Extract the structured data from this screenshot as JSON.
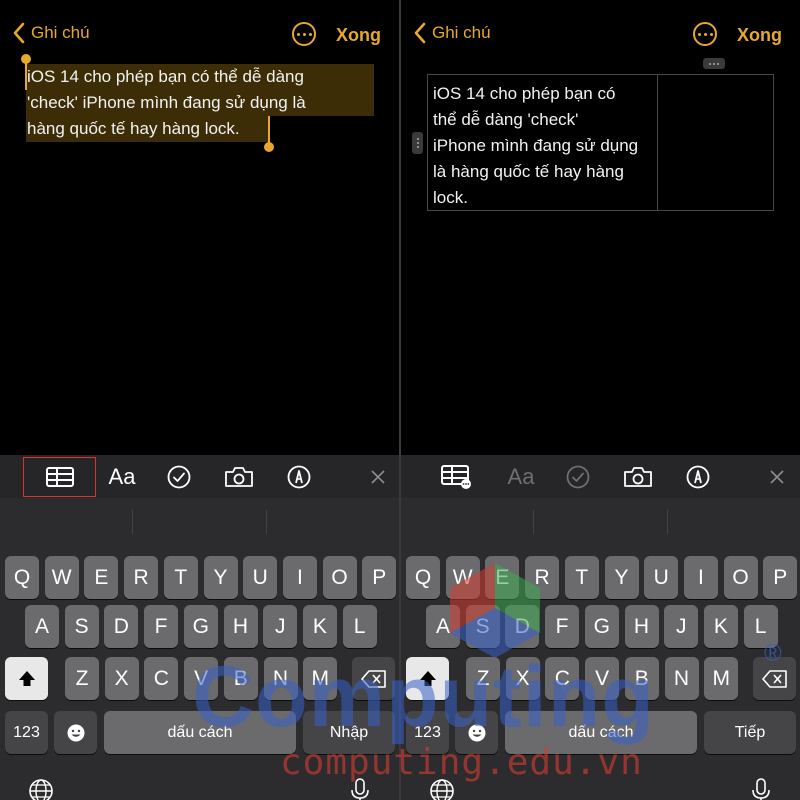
{
  "left_screen": {
    "nav": {
      "back_label": "Ghi chú",
      "done_label": "Xong"
    },
    "note_lines": [
      "iOS 14 cho phép bạn có thể dễ dàng",
      "'check' iPhone mình đang sử dụng là",
      "hàng quốc tế hay hàng lock."
    ],
    "toolbar": {
      "format_label": "Aa"
    },
    "keyboard": {
      "row1": [
        "Q",
        "W",
        "E",
        "R",
        "T",
        "Y",
        "U",
        "I",
        "O",
        "P"
      ],
      "row2": [
        "A",
        "S",
        "D",
        "F",
        "G",
        "H",
        "J",
        "K",
        "L"
      ],
      "row3": [
        "Z",
        "X",
        "C",
        "V",
        "B",
        "N",
        "M"
      ],
      "numbers_label": "123",
      "space_label": "dấu cách",
      "return_label": "Nhập"
    }
  },
  "right_screen": {
    "nav": {
      "back_label": "Ghi chú",
      "done_label": "Xong"
    },
    "table_cell_lines": [
      "iOS 14 cho phép bạn có",
      "thể dễ dàng 'check'",
      "iPhone mình đang sử dụng",
      "là hàng quốc tế hay hàng",
      "lock."
    ],
    "toolbar": {
      "format_label": "Aa"
    },
    "keyboard": {
      "row1": [
        "Q",
        "W",
        "E",
        "R",
        "T",
        "Y",
        "U",
        "I",
        "O",
        "P"
      ],
      "row2": [
        "A",
        "S",
        "D",
        "F",
        "G",
        "H",
        "J",
        "K",
        "L"
      ],
      "row3": [
        "Z",
        "X",
        "C",
        "V",
        "B",
        "N",
        "M"
      ],
      "numbers_label": "123",
      "space_label": "dấu cách",
      "return_label": "Tiếp"
    }
  },
  "watermark": {
    "brand": "Computing",
    "domain": "computing.edu.vn",
    "registered": "®"
  },
  "colors": {
    "accent": "#e6a82e",
    "selection": "#5a4511",
    "highlight_box": "#d9342b",
    "key": "#6b6b6e",
    "key_fn": "#454547"
  },
  "icons": [
    "chevron-left-icon",
    "more-circle-icon",
    "table-icon",
    "table-more-icon",
    "checklist-icon",
    "camera-icon",
    "markup-pen-icon",
    "close-icon",
    "shift-icon",
    "backspace-icon",
    "emoji-icon",
    "globe-icon",
    "microphone-icon"
  ]
}
